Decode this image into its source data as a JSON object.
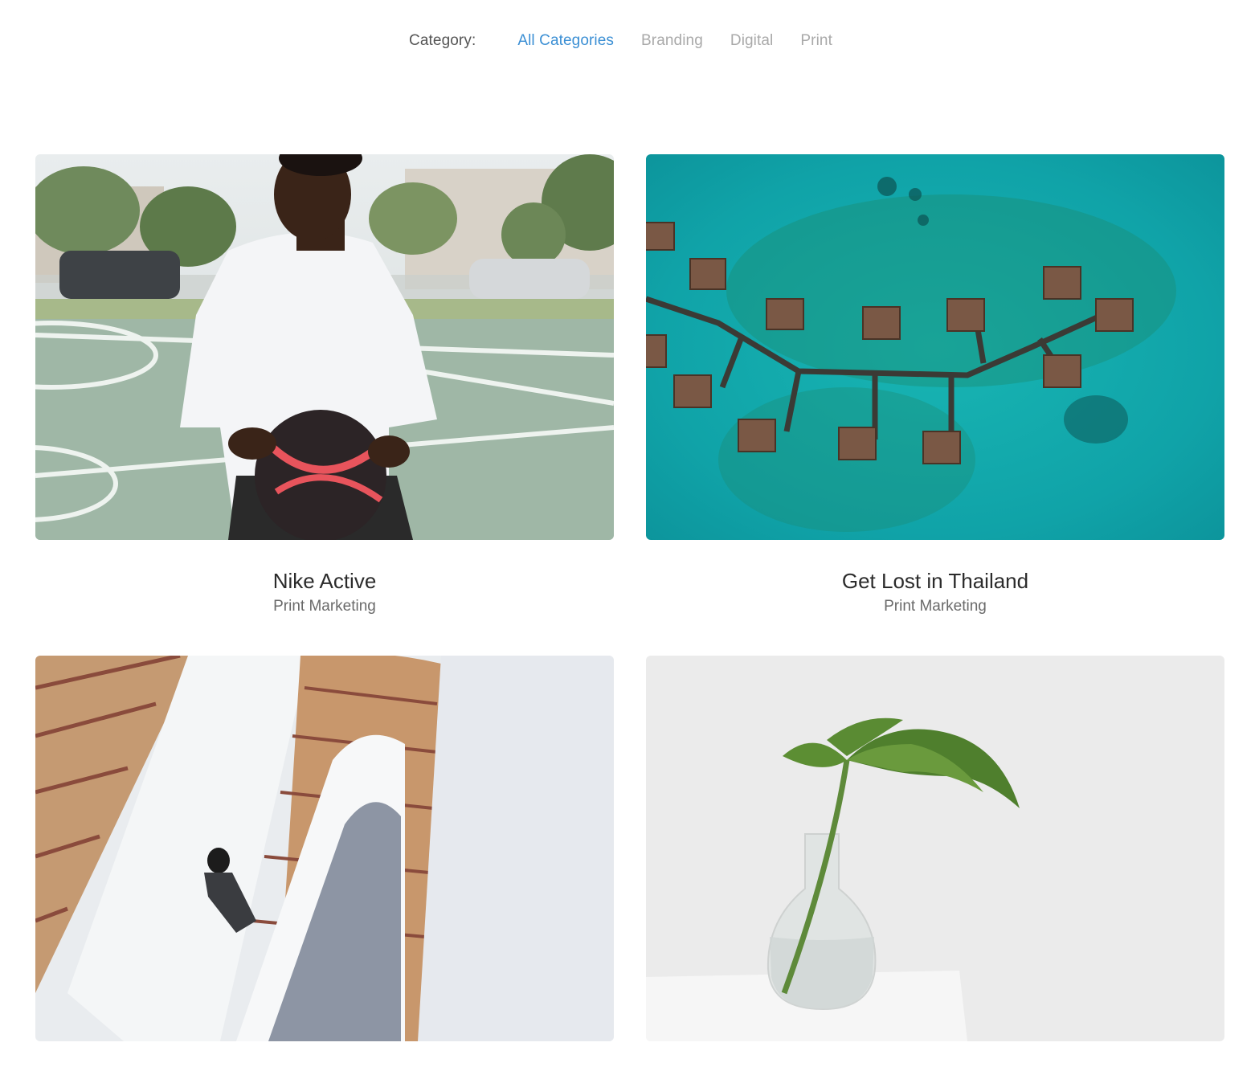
{
  "filter": {
    "label": "Category:",
    "items": [
      {
        "label": "All Categories",
        "active": true
      },
      {
        "label": "Branding",
        "active": false
      },
      {
        "label": "Digital",
        "active": false
      },
      {
        "label": "Print",
        "active": false
      }
    ],
    "active_color": "#3b8fd4",
    "inactive_color": "#a9a9a9"
  },
  "portfolio": {
    "items": [
      {
        "title": "Nike Active",
        "category": "Print Marketing",
        "image": "basketball-player-photo"
      },
      {
        "title": "Get Lost in Thailand",
        "category": "Print Marketing",
        "image": "overwater-bungalows-aerial-photo"
      },
      {
        "title": "",
        "category": "",
        "image": "spiral-staircase-photo"
      },
      {
        "title": "",
        "category": "",
        "image": "monstera-leaf-vase-photo"
      }
    ]
  }
}
